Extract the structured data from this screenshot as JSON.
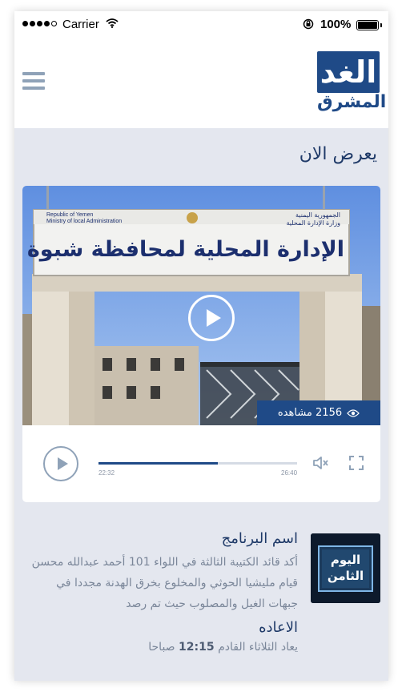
{
  "status_bar": {
    "carrier": "Carrier",
    "battery": "100%"
  },
  "header": {
    "logo_main": "الغد",
    "logo_sub": "المشرق",
    "menu_icon": "hamburger-icon"
  },
  "now_playing": {
    "title": "يعرض الان",
    "video": {
      "sign_line1": "الإدارة المحلية لمحافظة شبوة",
      "sign_en1": "Republic of Yemen",
      "sign_en2": "Ministry of local Administration",
      "sign_ar1": "الجمهورية اليمنية",
      "sign_ar2": "وزارة الإدارة المحلية"
    },
    "views_label": "2156 مشاهده",
    "current_time": "22:32",
    "total_time": "26:40",
    "progress": 0.6
  },
  "program": {
    "thumb_text1": "اليوم",
    "thumb_text2": "الثامن",
    "name": "اسم البرنامج",
    "description": "أكد قائد الكتيبة الثالثة في اللواء 101 أحمد عبدالله محسن قيام مليشيا الحوثي والمخلوع بخرق الهدنة مجددا في جبهات الغيل والمصلوب حيث تم رصد",
    "rerun_title": "الاعاده",
    "rerun_prefix": "يعاد الثلاثاء القادم",
    "rerun_time": "12:15",
    "rerun_suffix": "صباحا"
  },
  "colors": {
    "brand": "#1f4a87",
    "title": "#1f3a68",
    "muted": "#7a8699",
    "background": "#e4e7ef"
  }
}
